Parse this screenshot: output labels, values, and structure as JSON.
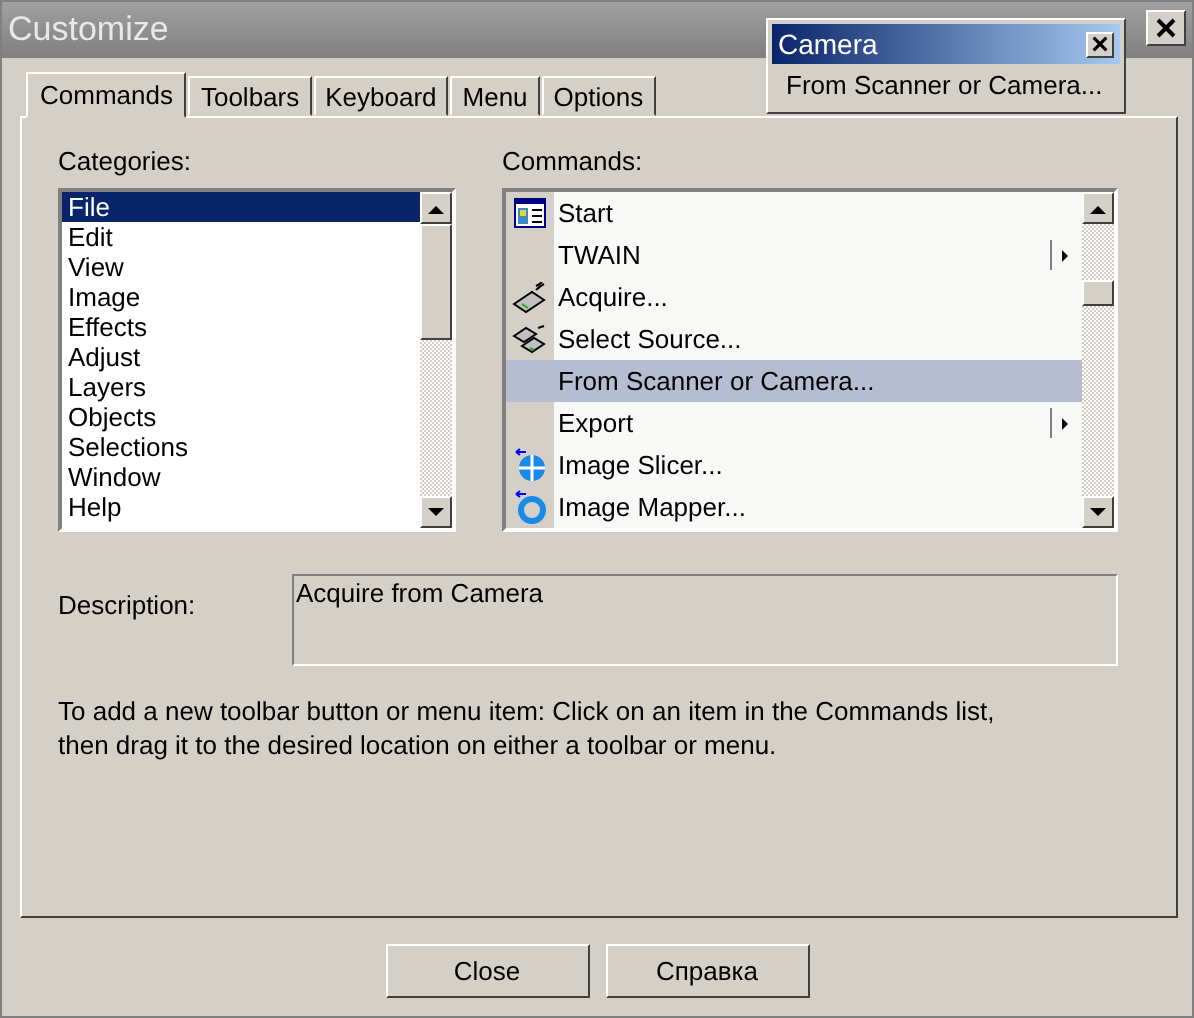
{
  "window": {
    "title": "Customize"
  },
  "toolbar_popup": {
    "title": "Camera",
    "item": "From Scanner or Camera..."
  },
  "tabs": [
    {
      "label": "Commands",
      "selected": true
    },
    {
      "label": "Toolbars",
      "selected": false
    },
    {
      "label": "Keyboard",
      "selected": false
    },
    {
      "label": "Menu",
      "selected": false
    },
    {
      "label": "Options",
      "selected": false
    }
  ],
  "categories": {
    "label": "Categories:",
    "items": [
      {
        "label": "File",
        "selected": true
      },
      {
        "label": "Edit",
        "selected": false
      },
      {
        "label": "View",
        "selected": false
      },
      {
        "label": "Image",
        "selected": false
      },
      {
        "label": "Effects",
        "selected": false
      },
      {
        "label": "Adjust",
        "selected": false
      },
      {
        "label": "Layers",
        "selected": false
      },
      {
        "label": "Objects",
        "selected": false
      },
      {
        "label": "Selections",
        "selected": false
      },
      {
        "label": "Window",
        "selected": false
      },
      {
        "label": "Help",
        "selected": false
      }
    ]
  },
  "commands": {
    "label": "Commands:",
    "items": [
      {
        "label": "Start",
        "kind": "window",
        "submenu": false,
        "selected": false
      },
      {
        "label": "TWAIN",
        "kind": "none",
        "submenu": true,
        "selected": false
      },
      {
        "label": "Acquire...",
        "kind": "scanner",
        "submenu": false,
        "selected": false
      },
      {
        "label": "Select Source...",
        "kind": "scanners",
        "submenu": false,
        "selected": false
      },
      {
        "label": "From Scanner or Camera...",
        "kind": "none",
        "submenu": false,
        "selected": true
      },
      {
        "label": "Export",
        "kind": "none",
        "submenu": true,
        "selected": false
      },
      {
        "label": "Image Slicer...",
        "kind": "crosshair",
        "submenu": false,
        "selected": false
      },
      {
        "label": "Image Mapper...",
        "kind": "ring",
        "submenu": false,
        "selected": false
      }
    ]
  },
  "description": {
    "label": "Description:",
    "value": "Acquire from Camera"
  },
  "hint": "To add a new toolbar button or menu item:  Click on an item in the Commands list, then drag it to the desired location on either a toolbar or menu.",
  "buttons": [
    "Close",
    "Справка"
  ]
}
